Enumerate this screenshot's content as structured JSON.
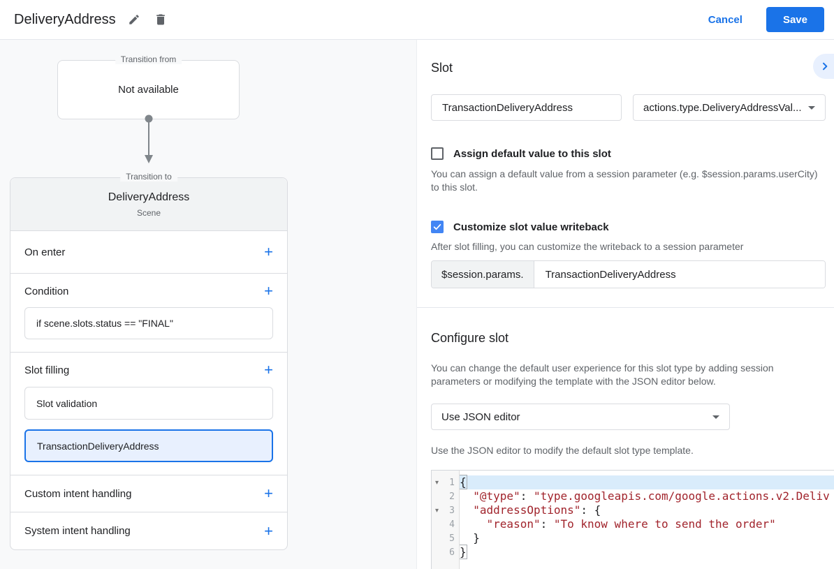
{
  "header": {
    "title": "DeliveryAddress",
    "cancel_label": "Cancel",
    "save_label": "Save"
  },
  "flow": {
    "transition_from_label": "Transition from",
    "transition_from_content": "Not available",
    "transition_to_label": "Transition to"
  },
  "scene": {
    "title": "DeliveryAddress",
    "subtitle": "Scene",
    "on_enter_label": "On enter",
    "condition_label": "Condition",
    "condition_value": "if scene.slots.status == \"FINAL\"",
    "slot_filling_label": "Slot filling",
    "slot_items": [
      {
        "label": "Slot validation",
        "selected": false
      },
      {
        "label": "TransactionDeliveryAddress",
        "selected": true
      }
    ],
    "custom_intent_label": "Custom intent handling",
    "system_intent_label": "System intent handling"
  },
  "slot_panel": {
    "heading": "Slot",
    "name_value": "TransactionDeliveryAddress",
    "type_value": "actions.type.DeliveryAddressVal...",
    "assign_default_label": "Assign default value to this slot",
    "assign_default_checked": false,
    "assign_default_description": "You can assign a default value from a session parameter (e.g. $session.params.userCity) to this slot.",
    "writeback_label": "Customize slot value writeback",
    "writeback_checked": true,
    "writeback_description": "After slot filling, you can customize the writeback to a session parameter",
    "writeback_prefix": "$session.params.",
    "writeback_value": "TransactionDeliveryAddress"
  },
  "configure": {
    "heading": "Configure slot",
    "description": "You can change the default user experience for this slot type by adding session parameters or modifying the template with the JSON editor below.",
    "mode_value": "Use JSON editor",
    "hint": "Use the JSON editor to modify the default slot type template.",
    "editor": {
      "lines": [
        {
          "num": "1",
          "fold": true,
          "active": true,
          "tokens": [
            {
              "text": "{",
              "style": "bracket"
            }
          ]
        },
        {
          "num": "2",
          "fold": false,
          "active": false,
          "tokens": [
            {
              "text": "  "
            },
            {
              "text": "\"@type\"",
              "style": "string"
            },
            {
              "text": ": "
            },
            {
              "text": "\"type.googleapis.com/google.actions.v2.Deliv",
              "style": "string"
            }
          ]
        },
        {
          "num": "3",
          "fold": true,
          "active": false,
          "tokens": [
            {
              "text": "  "
            },
            {
              "text": "\"addressOptions\"",
              "style": "string"
            },
            {
              "text": ": {"
            }
          ]
        },
        {
          "num": "4",
          "fold": false,
          "active": false,
          "tokens": [
            {
              "text": "    "
            },
            {
              "text": "\"reason\"",
              "style": "string"
            },
            {
              "text": ": "
            },
            {
              "text": "\"To know where to send the order\"",
              "style": "string"
            }
          ]
        },
        {
          "num": "5",
          "fold": false,
          "active": false,
          "tokens": [
            {
              "text": "  }"
            }
          ]
        },
        {
          "num": "6",
          "fold": false,
          "active": false,
          "tokens": [
            {
              "text": "}",
              "style": "bracket"
            }
          ]
        }
      ]
    }
  },
  "colors": {
    "accent": "#1a73e8",
    "checkbox_checked": "#4285f4",
    "selected_item_bg": "#e8f0fe",
    "selected_item_border": "#1a73e8",
    "code_string": "#a1242c",
    "active_line_bg": "#d9ecfb"
  }
}
